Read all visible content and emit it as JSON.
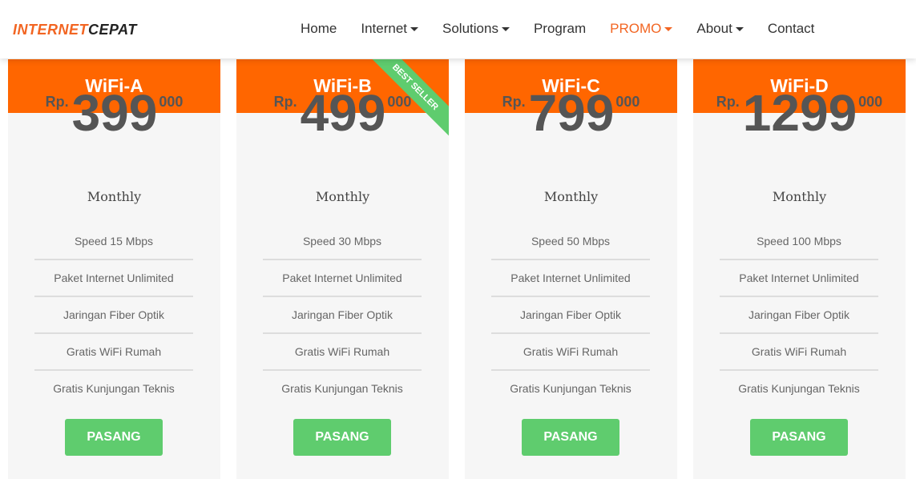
{
  "brand": {
    "part1": "INTERNET",
    "part2": "CEPAT"
  },
  "nav": [
    {
      "label": "Home",
      "dropdown": false
    },
    {
      "label": "Internet",
      "dropdown": true
    },
    {
      "label": "Solutions",
      "dropdown": true
    },
    {
      "label": "Program",
      "dropdown": false
    },
    {
      "label": "PROMO",
      "dropdown": true,
      "active": true
    },
    {
      "label": "About",
      "dropdown": true
    },
    {
      "label": "Contact",
      "dropdown": false
    }
  ],
  "plans": [
    {
      "name": "WiFi-A",
      "currency": "Rp.",
      "price": "399",
      "suffix": "000",
      "period": "Monthly",
      "features": [
        "Speed 15 Mbps",
        "Paket Internet Unlimited",
        "Jaringan Fiber Optik",
        "Gratis WiFi Rumah",
        "Gratis Kunjungan Teknis"
      ],
      "button": "PASANG"
    },
    {
      "name": "WiFi-B",
      "ribbon": "BEST SELLER",
      "currency": "Rp.",
      "price": "499",
      "suffix": "000",
      "period": "Monthly",
      "features": [
        "Speed 30 Mbps",
        "Paket Internet Unlimited",
        "Jaringan Fiber Optik",
        "Gratis WiFi Rumah",
        "Gratis Kunjungan Teknis"
      ],
      "button": "PASANG"
    },
    {
      "name": "WiFi-C",
      "currency": "Rp.",
      "price": "799",
      "suffix": "000",
      "period": "Monthly",
      "features": [
        "Speed 50 Mbps",
        "Paket Internet Unlimited",
        "Jaringan Fiber Optik",
        "Gratis WiFi Rumah",
        "Gratis Kunjungan Teknis"
      ],
      "button": "PASANG"
    },
    {
      "name": "WiFi-D",
      "currency": "Rp.",
      "price": "1299",
      "suffix": "000",
      "period": "Monthly",
      "features": [
        "Speed 100 Mbps",
        "Paket Internet Unlimited",
        "Jaringan Fiber Optik",
        "Gratis WiFi Rumah",
        "Gratis Kunjungan Teknis"
      ],
      "button": "PASANG"
    }
  ],
  "colors": {
    "accent": "#ff6600",
    "button": "#5fcc6e",
    "card": "#f6f6f6"
  }
}
